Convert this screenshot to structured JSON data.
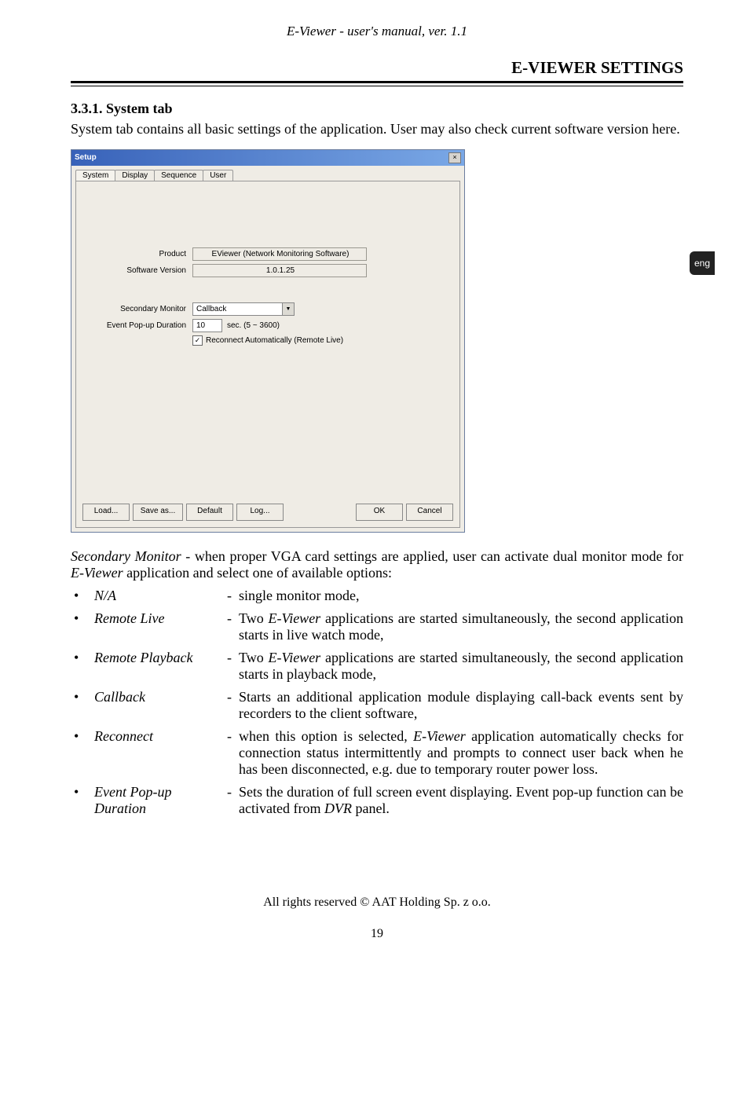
{
  "header": "E-Viewer - user's manual, ver. 1.1",
  "section_title": "E-VIEWER SETTINGS",
  "subsection_heading": "3.3.1. System tab",
  "intro_para": "System tab contains all basic settings of the application. User may also check current software version here.",
  "eng_label": "eng",
  "setup_window": {
    "title": "Setup",
    "tabs": [
      "System",
      "Display",
      "Sequence",
      "User"
    ],
    "product_label": "Product",
    "product_value": "EViewer (Network Monitoring Software)",
    "version_label": "Software Version",
    "version_value": "1.0.1.25",
    "sec_mon_label": "Secondary Monitor",
    "sec_mon_value": "Callback",
    "popup_label": "Event Pop-up Duration",
    "popup_value": "10",
    "popup_suffix": "sec. (5 ~ 3600)",
    "reconnect_label": "Reconnect Automatically (Remote Live)",
    "buttons": {
      "load": "Load...",
      "save_as": "Save as...",
      "default": "Default",
      "log": "Log...",
      "ok": "OK",
      "cancel": "Cancel"
    }
  },
  "def_intro_1": "Secondary Monitor",
  "def_intro_2": " - when proper VGA card settings are applied, user can activate dual monitor mode for ",
  "def_intro_3": "E-Viewer",
  "def_intro_4": " application and select one of available options:",
  "defs": [
    {
      "term": "N/A",
      "desc_parts": [
        {
          "text": "single monitor mode,",
          "ital": false
        }
      ]
    },
    {
      "term": "Remote Live",
      "desc_parts": [
        {
          "text": "Two ",
          "ital": false
        },
        {
          "text": "E-Viewer",
          "ital": true
        },
        {
          "text": " applications are started simultaneously, the second application starts in live watch mode,",
          "ital": false
        }
      ]
    },
    {
      "term": "Remote Playback",
      "desc_parts": [
        {
          "text": "Two ",
          "ital": false
        },
        {
          "text": "E-Viewer",
          "ital": true
        },
        {
          "text": " applications are started simultaneously, the second application starts in playback mode,",
          "ital": false
        }
      ]
    },
    {
      "term": "Callback",
      "desc_parts": [
        {
          "text": "Starts an additional application module displaying call-back events sent by recorders to the client software,",
          "ital": false
        }
      ]
    },
    {
      "term": "Reconnect",
      "desc_parts": [
        {
          "text": "when this option is selected, ",
          "ital": false
        },
        {
          "text": "E-Viewer",
          "ital": true
        },
        {
          "text": " application automatically checks for connection status intermittently and prompts to connect user back when he has been disconnected, e.g. due to temporary router power loss.",
          "ital": false
        }
      ]
    },
    {
      "term": "Event Pop-up Duration",
      "desc_parts": [
        {
          "text": "Sets the duration of full screen event displaying. Event pop-up function  can be activated from ",
          "ital": false
        },
        {
          "text": "DVR",
          "ital": true
        },
        {
          "text": " panel.",
          "ital": false
        }
      ]
    }
  ],
  "footer": "All rights reserved © AAT Holding Sp. z o.o.",
  "page_num": "19"
}
